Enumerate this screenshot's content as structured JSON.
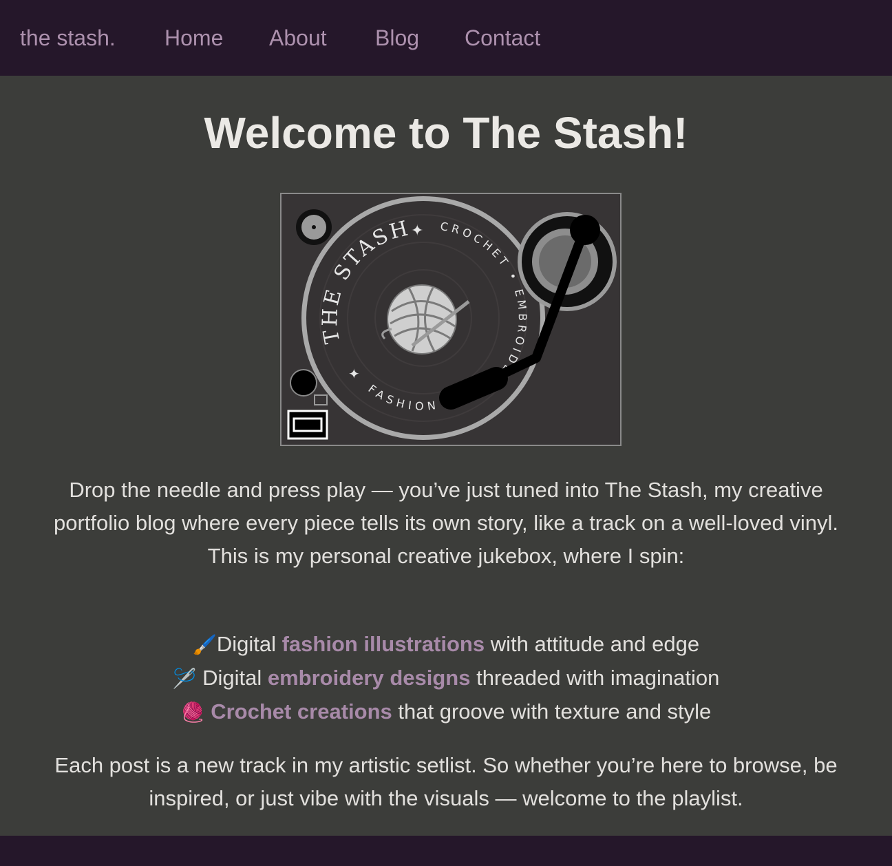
{
  "nav": {
    "brand": "the stash.",
    "links": [
      "Home",
      "About",
      "Blog",
      "Contact"
    ]
  },
  "hero": {
    "title": "Welcome to The Stash!",
    "logo_text": {
      "top": "THE STASH",
      "right": "CROCHET • EMBROIDERY",
      "bottom": "FASHION"
    }
  },
  "intro": {
    "line1": "Drop the needle and press play — you’ve just tuned into The Stash, my creative portfolio blog where every piece tells its own story, like a track on a well-loved vinyl.",
    "line2": "This is my personal creative jukebox, where I spin:"
  },
  "list": [
    {
      "icon": "🖌️",
      "pre": "Digital ",
      "highlight": "fashion illustrations",
      "post": " with attitude and edge"
    },
    {
      "icon": "🪡",
      "pre": " Digital ",
      "highlight": "embroidery designs",
      "post": " threaded with imagination"
    },
    {
      "icon": "🧶",
      "pre": " ",
      "highlight": "Crochet creations",
      "post": " that groove with texture and style"
    }
  ],
  "outro": "Each post is a new track in my artistic setlist. So whether you’re here to browse, be inspired, or just vibe with the visuals — welcome to the playlist.",
  "colors": {
    "nav_bg": "#25172a",
    "page_bg": "#3c3d3a",
    "link": "#ad91ae",
    "highlight": "#a88aa9"
  }
}
